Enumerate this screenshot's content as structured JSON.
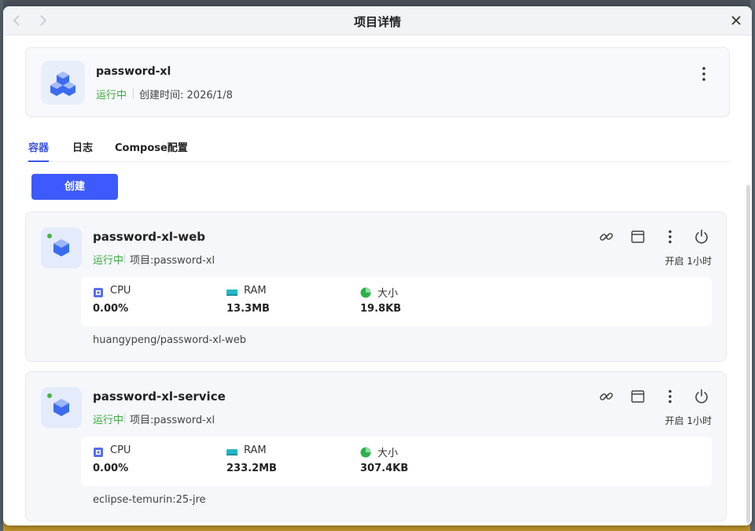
{
  "window": {
    "title": "项目详情"
  },
  "project": {
    "name": "password-xl",
    "status": "运行中",
    "created_label": "创建时间:",
    "created_value": "2026/1/8"
  },
  "tabs": [
    {
      "label": "容器",
      "active": true
    },
    {
      "label": "日志",
      "active": false
    },
    {
      "label": "Compose配置",
      "active": false
    }
  ],
  "create_button": "创建",
  "containers": [
    {
      "name": "password-xl-web",
      "status": "运行中",
      "project_label": "项目:",
      "project_value": "password-xl",
      "uptime": "开启 1小时",
      "stats": {
        "cpu_label": "CPU",
        "cpu_value": "0.00%",
        "ram_label": "RAM",
        "ram_value": "13.3MB",
        "size_label": "大小",
        "size_value": "19.8KB"
      },
      "image": "huangypeng/password-xl-web"
    },
    {
      "name": "password-xl-service",
      "status": "运行中",
      "project_label": "项目:",
      "project_value": "password-xl",
      "uptime": "开启 1小时",
      "stats": {
        "cpu_label": "CPU",
        "cpu_value": "0.00%",
        "ram_label": "RAM",
        "ram_value": "233.2MB",
        "size_label": "大小",
        "size_value": "307.4KB"
      },
      "image": "eclipse-temurin:25-jre"
    }
  ],
  "colors": {
    "accent": "#3d5afe",
    "status_green": "#3aab3c",
    "cube_blue": "#3b6cf0"
  },
  "icons": {
    "back": "chevron-left-icon",
    "forward": "chevron-right-icon",
    "close": "close-icon",
    "more": "more-vertical-icon",
    "link": "link-icon",
    "terminal": "window-icon",
    "power": "power-icon"
  }
}
